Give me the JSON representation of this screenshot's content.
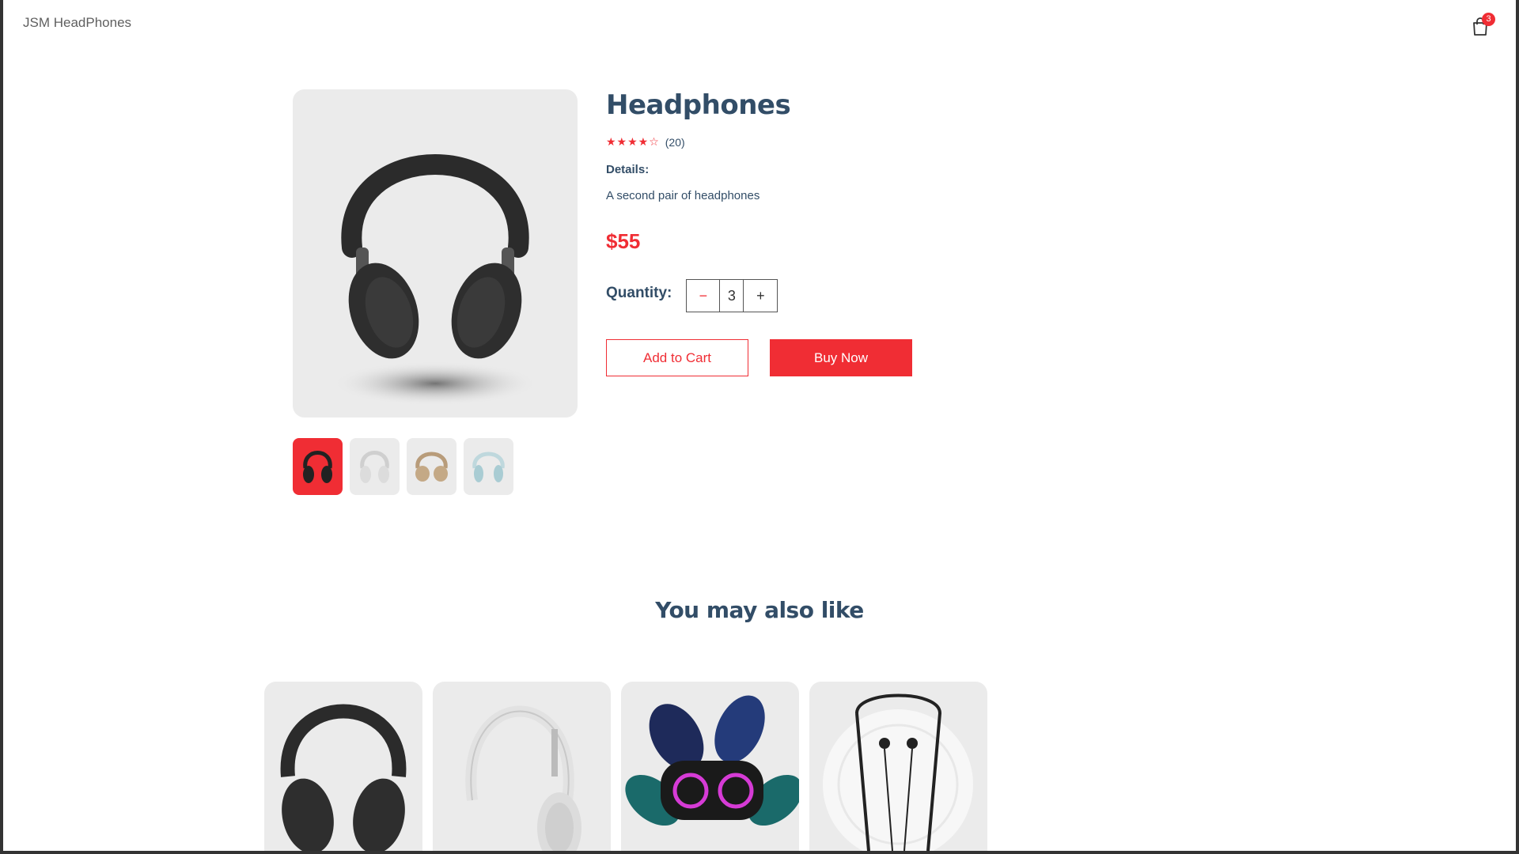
{
  "navbar": {
    "logo": "JSM HeadPhones",
    "cart_count": "3",
    "cart_icon": "shopping-bag-icon"
  },
  "product": {
    "name": "Headphones",
    "stars": "★★★★☆",
    "rating": 4,
    "review_count": "(20)",
    "details_label": "Details:",
    "description": "A second pair of headphones",
    "price": "$55",
    "quantity_label": "Quantity:",
    "quantity": "3",
    "minus": "−",
    "plus": "+",
    "add_to_cart": "Add to Cart",
    "buy_now": "Buy Now",
    "thumbnail_colors": [
      "black",
      "white",
      "beige",
      "light-blue"
    ],
    "selected_thumbnail": 0
  },
  "related": {
    "title": "You may also like",
    "items": [
      "black-headphones",
      "white-headphones",
      "speaker",
      "neckband-earphones"
    ]
  },
  "colors": {
    "accent": "#f02d34",
    "text": "#324d67",
    "card_bg": "#ebebeb"
  }
}
